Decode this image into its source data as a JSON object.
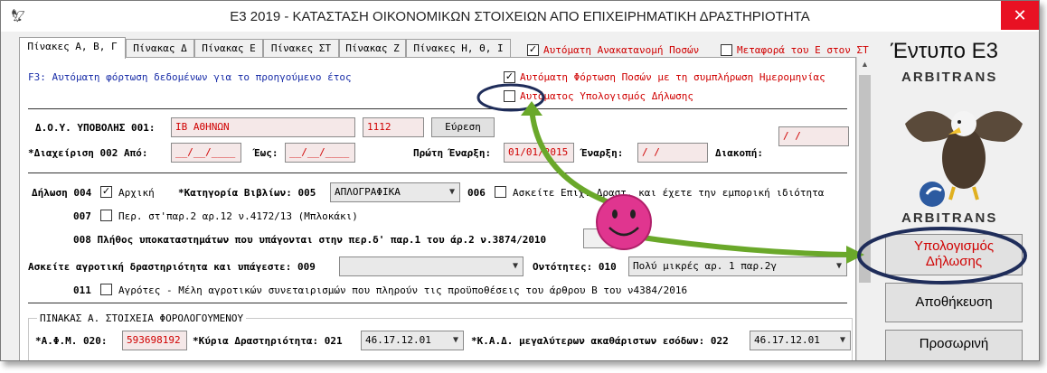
{
  "window": {
    "title": "Ε3 2019 - ΚΑΤΑΣΤΑΣΗ ΟΙΚΟΝΟΜΙΚΩΝ ΣΤΟΙΧΕΙΩΝ ΑΠΟ ΕΠΙΧΕΙΡΗΜΑΤΙΚΗ ΔΡΑΣΤΗΡΙΟΤΗΤΑ",
    "close_icon": "✕"
  },
  "tabs": [
    {
      "label": "Πίνακες Α, Β, Γ"
    },
    {
      "label": "Πίνακας Δ"
    },
    {
      "label": "Πίνακας Ε"
    },
    {
      "label": "Πίνακες ΣΤ"
    },
    {
      "label": "Πίνακας Ζ"
    },
    {
      "label": "Πίνακες Η, Θ, Ι"
    }
  ],
  "top_options": {
    "auto_redistribution": {
      "label": "Αυτόματη Ανακατανομή Ποσών",
      "checked": true
    },
    "transfer_to_e": {
      "label": "Μεταφορά του Ε στον ΣΤ",
      "checked": false
    }
  },
  "form": {
    "f3_hint": "F3: Αυτόματη φόρτωση δεδομένων για το προηγούμενο έτος",
    "auto_load": {
      "label": "Αυτόματη Φόρτωση Ποσών με τη συμπλήρωση Ημερομηνίας",
      "checked": true
    },
    "auto_calc": {
      "label": "Αυτόματος Υπολογισμός Δήλωσης",
      "checked": false
    },
    "doy_label": "Δ.Ο.Υ. ΥΠΟΒΟΛΗΣ 001:",
    "doy_value": "ΙΒ ΑΘΗΝΩΝ",
    "doy_code": "1112",
    "search_button": "Εύρεση",
    "management_label": "*Διαχείριση  002 Από:",
    "from_value": "__/__/____",
    "to_label": "Έως:",
    "to_value": "__/__/____",
    "first_start_label": "Πρώτη Έναρξη:",
    "first_start_value": "01/01/2015",
    "start_label": "Έναρξη:",
    "start_value": "  /  /",
    "stop_label": "Διακοπή:",
    "stop_value": "  /  /",
    "declaration_label": "Δήλωση 004",
    "initial": {
      "label": "Αρχική",
      "checked": true
    },
    "books_category_label": "*Κατηγορία Βιβλίων: 005",
    "books_category_value": "ΑΠΛΟΓΡΑΦΙΚΑ",
    "field_006_label": "006",
    "field_006_text": "Ασκείτε Επιχ. Δραστ. και έχετε την εμπορική ιδιότητα",
    "field_007_label": "007",
    "field_007_text": "Περ. στ'παρ.2 αρ.12 ν.4172/13 (Μπλοκάκι)",
    "field_008_text": "008 Πλήθος υποκαταστημάτων που υπάγονται στην περ.δ' παρ.1 του άρ.2 ν.3874/2010",
    "agri_label": "Ασκείτε αγροτική δραστηριότητα και υπάγεστε: 009",
    "entities_label": "Οντότητες: 010",
    "entities_value": "Πολύ μικρές αρ. 1 παρ.2γ",
    "field_011_label": "011",
    "field_011_text": "Αγρότες - Μέλη αγροτικών συνεταιρισμών που πληρούν τις προϋποθέσεις του άρθρου Β του ν4384/2016",
    "group_title": "ΠΙΝΑΚΑΣ Α. ΣΤΟΙΧΕΙΑ ΦΟΡΟΛΟΓΟΥΜΕΝΟΥ",
    "afm_label": "*Α.Φ.Μ. 020:",
    "afm_value": "593698192",
    "main_activity_label": "*Κύρια Δραστηριότητα: 021",
    "main_activity_value": "46.17.12.01",
    "kad_label": "*Κ.Α.Δ. μεγαλύτερων ακαθάριστων εσόδων: 022",
    "kad_value": "46.17.12.01"
  },
  "sidebar": {
    "form_title": "Έντυπο Ε3",
    "brand_top": "ARBITRANS",
    "brand_bottom": "ARBITRANS",
    "calc_button": "Υπολογισμός Δήλωσης",
    "save_button": "Αποθήκευση",
    "temp_button": "Προσωρινή"
  },
  "colors": {
    "red_label": "#d00000",
    "annotation_green": "#6aa82a",
    "annotation_navy": "#1f2d5a",
    "smiley": "#e0358f"
  }
}
